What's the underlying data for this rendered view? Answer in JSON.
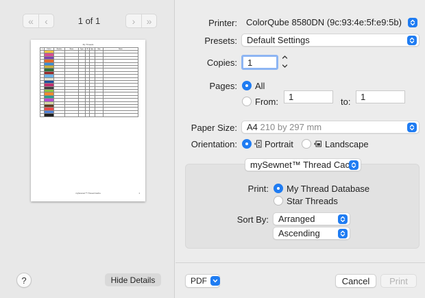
{
  "preview": {
    "page_indicator": "1 of 1",
    "document": {
      "title": "My Threads",
      "footer": "mySewnet™ Thread Cache",
      "page_number": "1",
      "columns": [
        "#",
        "Colors",
        "Number",
        "Name",
        "Type",
        "W",
        "Spo.",
        "Size",
        "Notes"
      ],
      "row_colors": [
        "#f4c542",
        "#d94e8f",
        "#7a3fb0",
        "#e36a2c",
        "#3a8fd6",
        "#c7b23a",
        "#2f6e3c",
        "#9b2a2a",
        "#6cb2e8",
        "#e8e4d0",
        "#1b4e9e",
        "#c22f6f",
        "#3d3d3d",
        "#8dc63f",
        "#f18a2e",
        "#2a9c8e",
        "#b54bd1",
        "#d9d9a3",
        "#5f3a1f",
        "#e84a4a",
        "#4d7fd8",
        "#222222"
      ]
    }
  },
  "left_bottom": {
    "help_label": "?",
    "hide_details_label": "Hide Details"
  },
  "settings": {
    "printer_label": "Printer:",
    "printer_value": "ColorQube 8580DN (9c:93:4e:5f:e9:5b)",
    "presets_label": "Presets:",
    "presets_value": "Default Settings",
    "copies_label": "Copies:",
    "copies_value": "1",
    "pages_label": "Pages:",
    "pages_all_label": "All",
    "pages_from_label": "From:",
    "pages_from_value": "1",
    "pages_to_label": "to:",
    "pages_to_value": "1",
    "paper_size_label": "Paper Size:",
    "paper_size_value": "A4",
    "paper_size_detail": "210 by 297 mm",
    "orientation_label": "Orientation:",
    "orientation_portrait": "Portrait",
    "orientation_landscape": "Landscape"
  },
  "app_section": {
    "selector_value": "mySewnet™ Thread Cache",
    "print_label": "Print:",
    "print_option_1": "My Thread Database",
    "print_option_2": "Star Threads",
    "sort_by_label": "Sort By:",
    "sort_by_value": "Arranged",
    "order_value": "Ascending"
  },
  "footer": {
    "pdf_label": "PDF",
    "cancel_label": "Cancel",
    "print_label": "Print"
  },
  "colors": {
    "accent": "#1f7cf2",
    "focus_ring": "#8db5f3"
  }
}
